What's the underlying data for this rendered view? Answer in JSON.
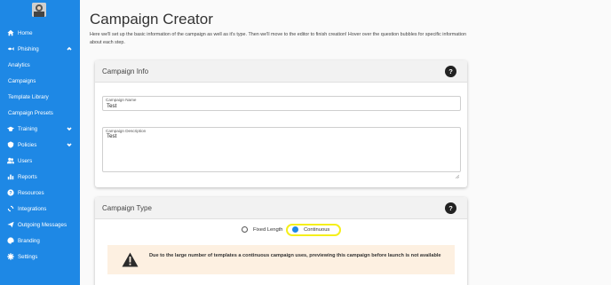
{
  "sidebar": {
    "items": [
      {
        "label": "Home",
        "icon": "home-icon"
      },
      {
        "label": "Phishing",
        "icon": "fish-icon",
        "expanded": true
      },
      {
        "label": "Analytics",
        "sub": true
      },
      {
        "label": "Campaigns",
        "sub": true
      },
      {
        "label": "Template Library",
        "sub": true
      },
      {
        "label": "Campaign Presets",
        "sub": true
      },
      {
        "label": "Training",
        "icon": "graduation-cap-icon"
      },
      {
        "label": "Policies",
        "icon": "policies-icon"
      },
      {
        "label": "Users",
        "icon": "users-icon"
      },
      {
        "label": "Reports",
        "icon": "reports-icon"
      },
      {
        "label": "Resources",
        "icon": "question-circle-icon"
      },
      {
        "label": "Integrations",
        "icon": "sync-icon"
      },
      {
        "label": "Outgoing Messages",
        "icon": "paper-plane-icon"
      },
      {
        "label": "Branding",
        "icon": "palette-icon"
      },
      {
        "label": "Settings",
        "icon": "gear-icon"
      }
    ],
    "accent_color": "#1e88e5"
  },
  "page": {
    "title": "Campaign Creator",
    "intro": "Here we'll set up the basic information of the campaign as well as it's type. Then we'll move to the editor to finish creation! Hover over the question bubbles for specific information about each step."
  },
  "campaign_info": {
    "header": "Campaign Info",
    "help": "?",
    "name_label": "Campaign Name",
    "name_value": "Test",
    "description_label": "Campaign Description",
    "description_value": "Test"
  },
  "campaign_type": {
    "header": "Campaign Type",
    "help": "?",
    "options": [
      "Fixed Length",
      "Continuous"
    ],
    "selected": "Continuous",
    "warning": "Due to the large number of templates a continuous campaign uses, previewing this campaign before launch is not available",
    "warning_bg": "#fdf0e1"
  }
}
